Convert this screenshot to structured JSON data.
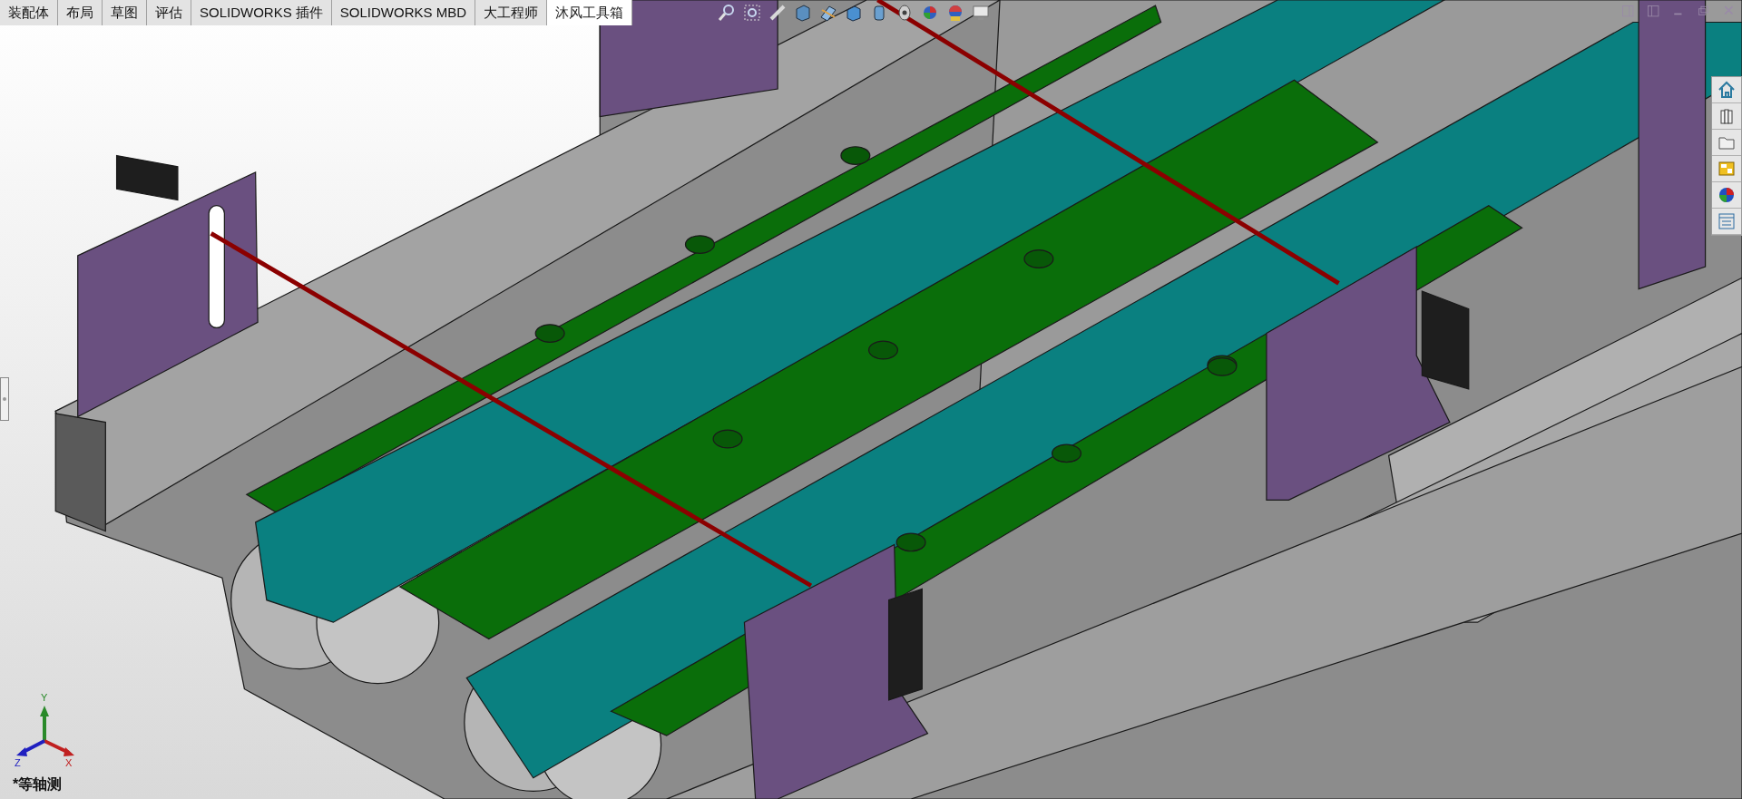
{
  "tabs": [
    {
      "label": "装配体",
      "selected": false
    },
    {
      "label": "布局",
      "selected": false
    },
    {
      "label": "草图",
      "selected": false
    },
    {
      "label": "评估",
      "selected": false
    },
    {
      "label": "SOLIDWORKS 插件",
      "selected": false
    },
    {
      "label": "SOLIDWORKS MBD",
      "selected": false
    },
    {
      "label": "大工程师",
      "selected": false
    },
    {
      "label": "沐风工具箱",
      "selected": true
    }
  ],
  "triad": {
    "y": "Y",
    "x": "X",
    "z": "Z"
  },
  "view_label": "*等轴测"
}
